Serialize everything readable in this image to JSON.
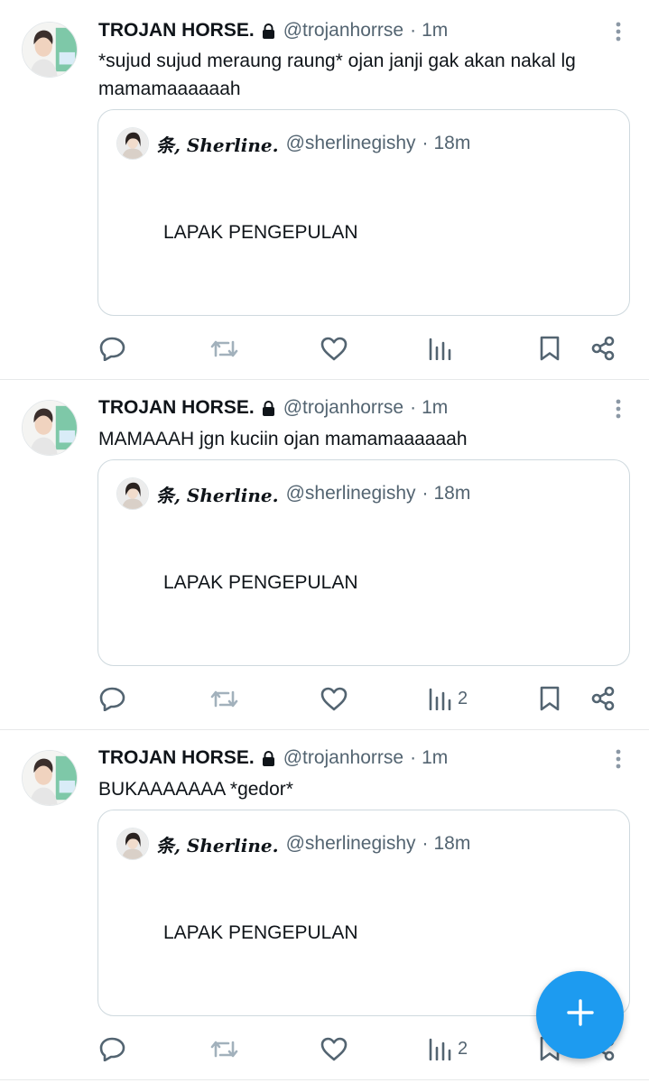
{
  "feed": [
    {
      "author": {
        "name": "TROJAN HORSE.",
        "handle": "@trojanhorrse",
        "protected": true,
        "avatar_icon": "user-avatar-icon"
      },
      "separator": "·",
      "time": "1m",
      "text": "*sujud sujud meraung raung* ojan janji gak akan nakal lg mamamaaaaaah",
      "quote": {
        "author": {
          "name": "条, Sherline.",
          "handle": "@sherlinegishy"
        },
        "separator": "·",
        "time": "18m",
        "text": "LAPAK PENGEPULAN"
      },
      "actions": {
        "reply": "",
        "retweet": "",
        "like": "",
        "views": "",
        "bookmark": "",
        "share": ""
      }
    },
    {
      "author": {
        "name": "TROJAN HORSE.",
        "handle": "@trojanhorrse",
        "protected": true,
        "avatar_icon": "user-avatar-icon"
      },
      "separator": "·",
      "time": "1m",
      "text": "MAMAAAH jgn kuciin ojan mamamaaaaaah",
      "quote": {
        "author": {
          "name": "条, Sherline.",
          "handle": "@sherlinegishy"
        },
        "separator": "·",
        "time": "18m",
        "text": "LAPAK PENGEPULAN"
      },
      "actions": {
        "reply": "",
        "retweet": "",
        "like": "",
        "views": "2",
        "bookmark": "",
        "share": ""
      }
    },
    {
      "author": {
        "name": "TROJAN HORSE.",
        "handle": "@trojanhorrse",
        "protected": true,
        "avatar_icon": "user-avatar-icon"
      },
      "separator": "·",
      "time": "1m",
      "text": "BUKAAAAAAA *gedor*",
      "quote": {
        "author": {
          "name": "条, Sherline.",
          "handle": "@sherlinegishy"
        },
        "separator": "·",
        "time": "18m",
        "text": "LAPAK PENGEPULAN"
      },
      "actions": {
        "reply": "",
        "retweet": "",
        "like": "",
        "views": "2",
        "bookmark": "",
        "share": ""
      }
    }
  ],
  "compose_button": {
    "icon": "plus-icon"
  },
  "colors": {
    "accent": "#1d9bf0",
    "text_primary": "#0f1419",
    "text_secondary": "#536471",
    "border": "#cfd9de",
    "retweet_disabled": "#a2b1bc"
  }
}
